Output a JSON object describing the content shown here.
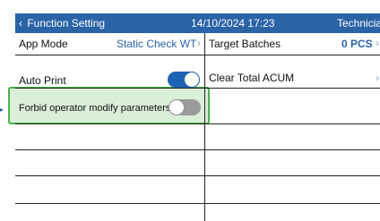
{
  "header": {
    "back_label": "Function Setting",
    "datetime": "14/10/2024 17:23",
    "role": "Technicia"
  },
  "left_rows": [
    {
      "label": "App Mode",
      "value": "Static Check WT",
      "type": "select"
    },
    {
      "label": "Auto Print",
      "type": "toggle",
      "state": "on"
    },
    {
      "label": "Forbid operator modify parameters",
      "type": "toggle",
      "state": "off",
      "highlighted": true
    }
  ],
  "right_rows": [
    {
      "label": "Target Batches",
      "value": "0 PCS"
    },
    {
      "label": "Clear Total ACUM"
    }
  ],
  "colors": {
    "header_bg": "#2a63a6",
    "accent": "#1e64b4",
    "highlight_border": "#49b24a"
  }
}
